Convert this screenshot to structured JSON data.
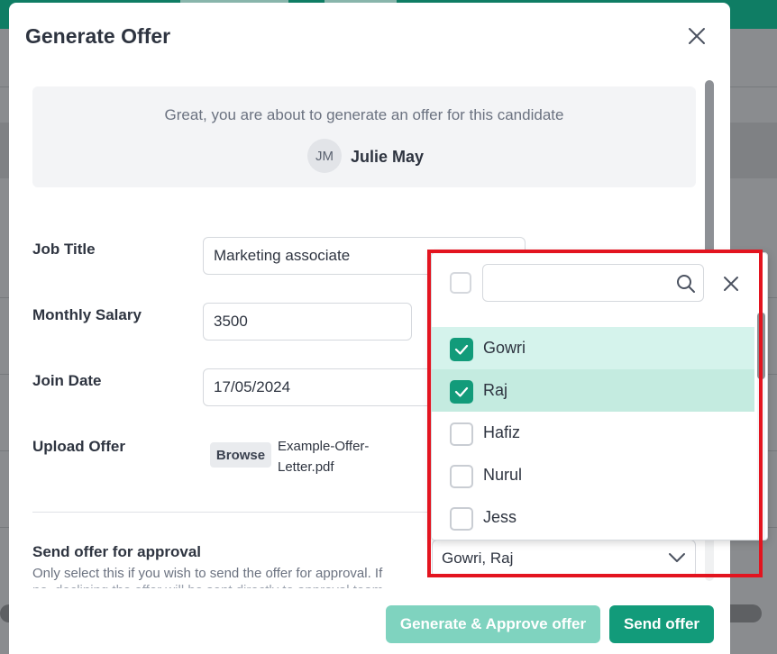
{
  "modal": {
    "title": "Generate Offer",
    "intro": "Great, you are about to generate an offer for this candidate",
    "candidate": {
      "initials": "JM",
      "name": "Julie May"
    }
  },
  "form": {
    "job_title": {
      "label": "Job Title",
      "value": "Marketing associate"
    },
    "monthly_salary": {
      "label": "Monthly Salary",
      "value": "3500"
    },
    "join_date": {
      "label": "Join Date",
      "value": "17/05/2024"
    },
    "upload_offer": {
      "label": "Upload Offer",
      "browse": "Browse",
      "file_line1": "Example-Offer-",
      "file_line2": "Letter.pdf"
    },
    "approval": {
      "title": "Send offer for approval",
      "description": "Only select this if you wish to send the offer for approval. If",
      "description_cut": "no, declining the offer will be sent directly to approval team",
      "selected": "Gowri, Raj"
    }
  },
  "buttons": {
    "generate_approve": "Generate & Approve offer",
    "send": "Send offer"
  },
  "dropdown": {
    "search_placeholder": "",
    "items": [
      {
        "name": "Gowri",
        "checked": true
      },
      {
        "name": "Raj",
        "checked": true
      },
      {
        "name": "Hafiz",
        "checked": false
      },
      {
        "name": "Nurul",
        "checked": false
      },
      {
        "name": "Jess",
        "checked": false
      }
    ]
  },
  "colors": {
    "primary": "#129b7a",
    "primary_light": "#7fd3bf",
    "highlight": "#e3141f",
    "checked_row": "#d5f3ec"
  }
}
